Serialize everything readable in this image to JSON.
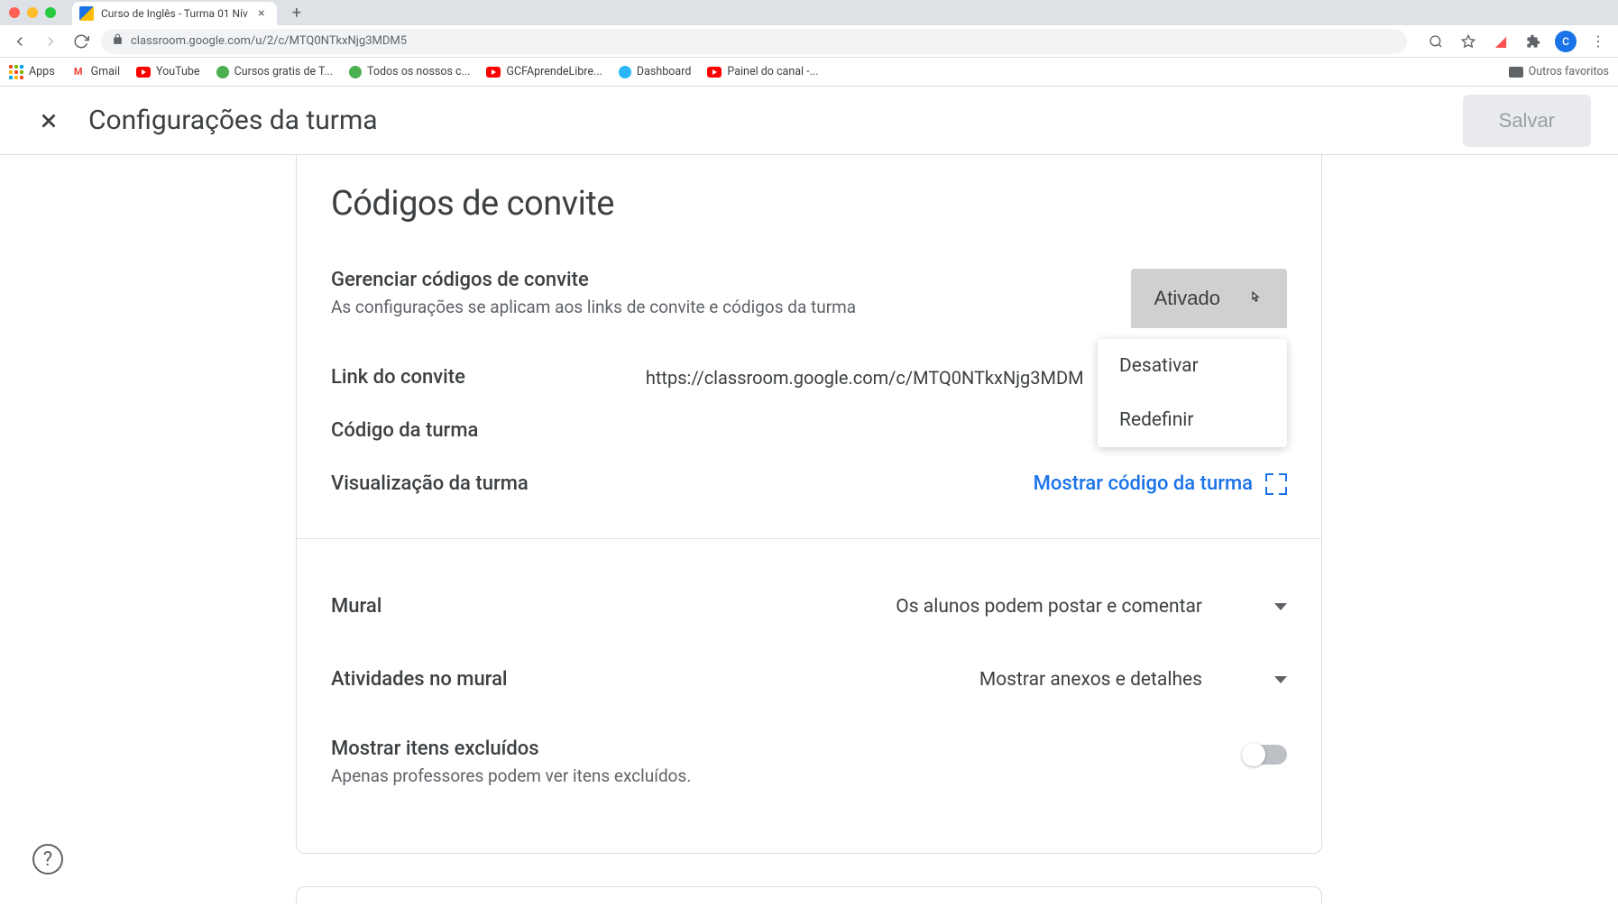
{
  "browser": {
    "tab_title": "Curso de Inglês - Turma 01 Nív",
    "url": "classroom.google.com/u/2/c/MTQ0NTkxNjg3MDM5",
    "bookmarks": [
      {
        "label": "Apps",
        "icon": "apps"
      },
      {
        "label": "Gmail",
        "icon": "gmail"
      },
      {
        "label": "YouTube",
        "icon": "youtube"
      },
      {
        "label": "Cursos gratis de T...",
        "icon": "globe"
      },
      {
        "label": "Todos os nossos c...",
        "icon": "globe"
      },
      {
        "label": "GCFAprendeLibre...",
        "icon": "youtube"
      },
      {
        "label": "Dashboard",
        "icon": "globe"
      },
      {
        "label": "Painel do canal -...",
        "icon": "youtube"
      }
    ],
    "other_bookmarks": "Outros favoritos",
    "avatar_letter": "C"
  },
  "header": {
    "title": "Configurações da turma",
    "save_label": "Salvar"
  },
  "invite": {
    "section_title": "Códigos de convite",
    "manage_title": "Gerenciar códigos de convite",
    "manage_sub": "As configurações se aplicam aos links de convite e códigos da turma",
    "status_label": "Ativado",
    "menu": {
      "deactivate": "Desativar",
      "reset": "Redefinir"
    },
    "link_label": "Link do convite",
    "link_value": "https://classroom.google.com/c/MTQ0NTkxNjg3MDM",
    "code_label": "Código da turma",
    "view_label": "Visualização da turma",
    "show_code": "Mostrar código da turma"
  },
  "general": {
    "mural_label": "Mural",
    "mural_value": "Os alunos podem postar e comentar",
    "activities_label": "Atividades no mural",
    "activities_value": "Mostrar anexos e detalhes",
    "deleted_label": "Mostrar itens excluídos",
    "deleted_sub": "Apenas professores podem ver itens excluídos."
  }
}
